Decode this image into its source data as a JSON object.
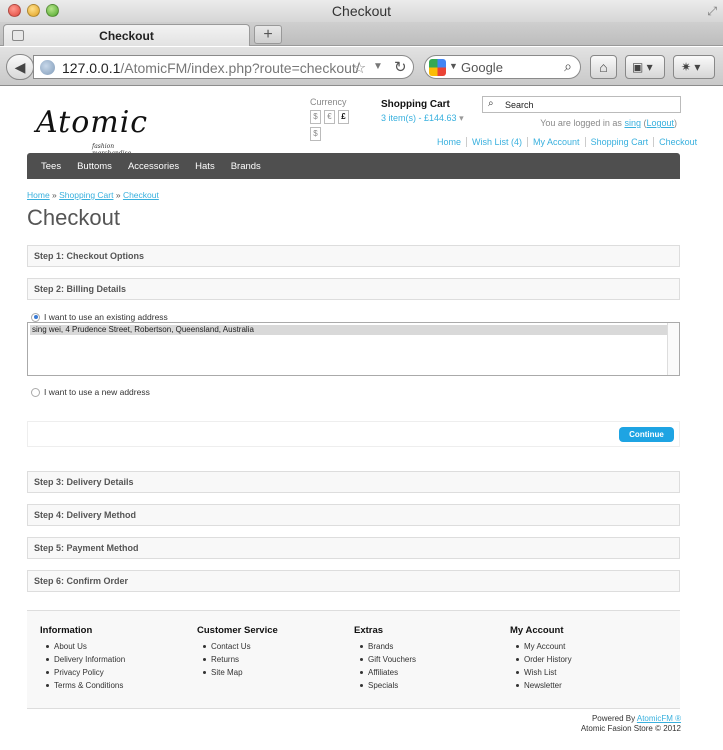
{
  "window": {
    "title": "Checkout"
  },
  "tabs": [
    {
      "label": "Checkout"
    }
  ],
  "newtab_label": "+",
  "toolbar": {
    "url_host": "127.0.0.1",
    "url_path": "/AtomicFM/index.php?route=checkout/",
    "search_placeholder": "Google"
  },
  "site": {
    "logo_text": "Atomic",
    "logo_sub": "fashion merchandise",
    "currency_label": "Currency",
    "currencies": [
      "$",
      "€",
      "£",
      "$"
    ],
    "active_currency": "£",
    "cart_title": "Shopping Cart",
    "cart_summary": "3 item(s) - £144.63",
    "search_value": "Search",
    "logged_in_prefix": "You are logged in as",
    "username": "sing",
    "logout": "Logout",
    "top_links": [
      "Home",
      "Wish List (4)",
      "My Account",
      "Shopping Cart",
      "Checkout"
    ],
    "menu": [
      "Tees",
      "Buttoms",
      "Accessories",
      "Hats",
      "Brands"
    ],
    "breadcrumb": [
      "Home",
      "Shopping Cart",
      "Checkout"
    ],
    "page_title": "Checkout"
  },
  "steps": [
    "Step 1: Checkout Options",
    "Step 2: Billing Details",
    "Step 3: Delivery Details",
    "Step 4: Delivery Method",
    "Step 5: Payment Method",
    "Step 6: Confirm Order"
  ],
  "billing": {
    "existing_label": "I want to use an existing address",
    "selected_address": "sing wei, 4 Prudence Street, Robertson, Queensland, Australia",
    "new_label": "I want to use a new address",
    "continue_label": "Continue"
  },
  "footer": {
    "columns": [
      {
        "title": "Information",
        "links": [
          "About Us",
          "Delivery Information",
          "Privacy Policy",
          "Terms & Conditions"
        ]
      },
      {
        "title": "Customer Service",
        "links": [
          "Contact Us",
          "Returns",
          "Site Map"
        ]
      },
      {
        "title": "Extras",
        "links": [
          "Brands",
          "Gift Vouchers",
          "Affiliates",
          "Specials"
        ]
      },
      {
        "title": "My Account",
        "links": [
          "My Account",
          "Order History",
          "Wish List",
          "Newsletter"
        ]
      }
    ],
    "powered_prefix": "Powered By",
    "powered_link": "AtomicFM ®",
    "copyright": "Atomic Fasion Store © 2012"
  }
}
